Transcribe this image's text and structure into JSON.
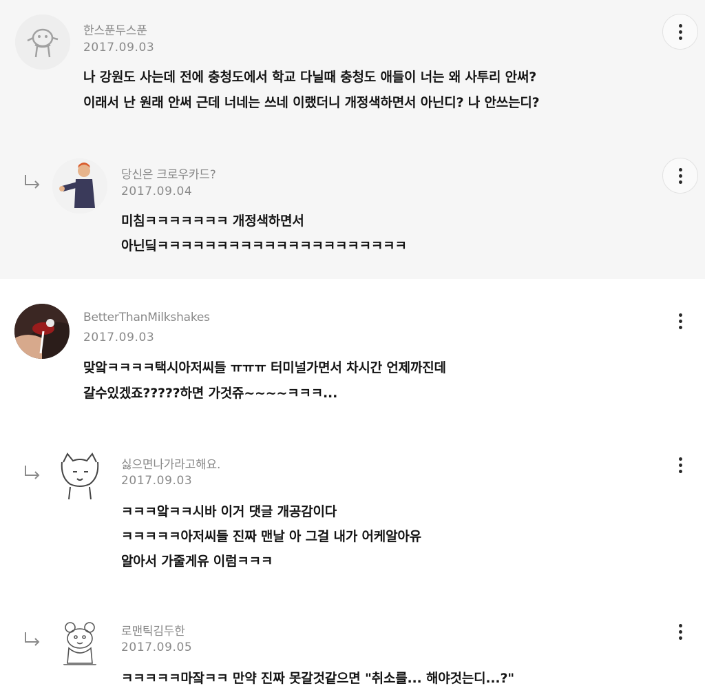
{
  "comments": [
    {
      "author": "한스푼두스푼",
      "date": "2017.09.03",
      "lines": [
        "나 강원도 사는데 전에 충청도에서 학교 다닐때 충청도 애들이 너는 왜 사투리 안써?",
        "이래서 난 원래 안써 근데 너네는 쓰네 이랬더니 개정색하면서 아닌디? 나 안쓰는디?"
      ],
      "avatar_icon": "mascot-avatar-icon",
      "more_icon": "more-vertical-icon"
    },
    {
      "author": "당신은 크로우카드?",
      "date": "2017.09.04",
      "lines": [
        "미침ㅋㅋㅋㅋㅋㅋㅋ 개정색하면서",
        "아닌딬ㅋㅋㅋㅋㅋㅋㅋㅋㅋㅋㅋㅋㅋㅋㅋㅋㅋㅋㅋㅋㅋ"
      ],
      "avatar_icon": "person-photo-avatar-icon",
      "more_icon": "more-vertical-icon",
      "reply": true
    },
    {
      "author": "BetterThanMilkshakes",
      "date": "2017.09.03",
      "lines": [
        "맞앜ㅋㅋㅋㅋ택시아저씨들 ㅠㅠㅠ 터미널가면서 차시간 언제까진데",
        "갈수있겠죠?????하면 가것쥬~~~~ㅋㅋㅋ..."
      ],
      "avatar_icon": "lips-photo-avatar-icon",
      "more_icon": "more-vertical-icon"
    },
    {
      "author": "싫으면나가라고해요.",
      "date": "2017.09.03",
      "lines": [
        "ㅋㅋㅋ앜ㅋㅋ시바 이거 댓글 개공감이다",
        "ㅋㅋㅋㅋㅋ아저씨들 진짜 맨날 아 그걸 내가 어케알아유",
        "알아서 가줄게유 이럼ㅋㅋㅋ"
      ],
      "avatar_icon": "cartoon-cat-avatar-icon",
      "more_icon": "more-vertical-icon",
      "reply": true
    },
    {
      "author": "로맨틱김두한",
      "date": "2017.09.05",
      "lines": [
        "ㅋㅋㅋㅋㅋ마잨ㅋㅋ 만약 진짜 못갈것같으면 \"취소를... 해야것는디...?\""
      ],
      "avatar_icon": "sketch-bear-avatar-icon",
      "more_icon": "more-vertical-icon",
      "reply": true
    }
  ],
  "colors": {
    "reply_section_bg": "#f6f6f6",
    "page_bg": "#ffffff",
    "meta_text": "#888888",
    "body_text": "#141414"
  }
}
